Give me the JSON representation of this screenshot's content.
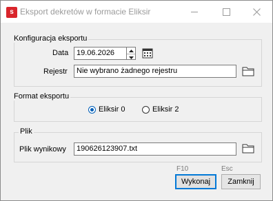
{
  "window": {
    "title": "Eksport dekretów w formacie Eliksir",
    "app_icon_letter": "s",
    "accent_color": "#0078d7",
    "brand_color": "#d9252b"
  },
  "config_group": {
    "label": "Konfiguracja eksportu",
    "date_label": "Data",
    "date_value": "19.06.2026",
    "register_label": "Rejestr",
    "register_value": "Nie wybrano żadnego rejestru"
  },
  "format_group": {
    "label": "Format eksportu",
    "options": [
      {
        "label": "Eliksir 0",
        "checked": true
      },
      {
        "label": "Eliksir 2",
        "checked": false
      }
    ]
  },
  "file_group": {
    "label": "Plik",
    "output_label": "Plik wynikowy",
    "output_value": "190626123907.txt"
  },
  "actions": {
    "execute_shortcut": "F10",
    "execute_label": "Wykonaj",
    "close_shortcut": "Esc",
    "close_label": "Zamknij"
  },
  "icons": {
    "calendar": "calendar-icon",
    "folder": "folder-icon"
  }
}
